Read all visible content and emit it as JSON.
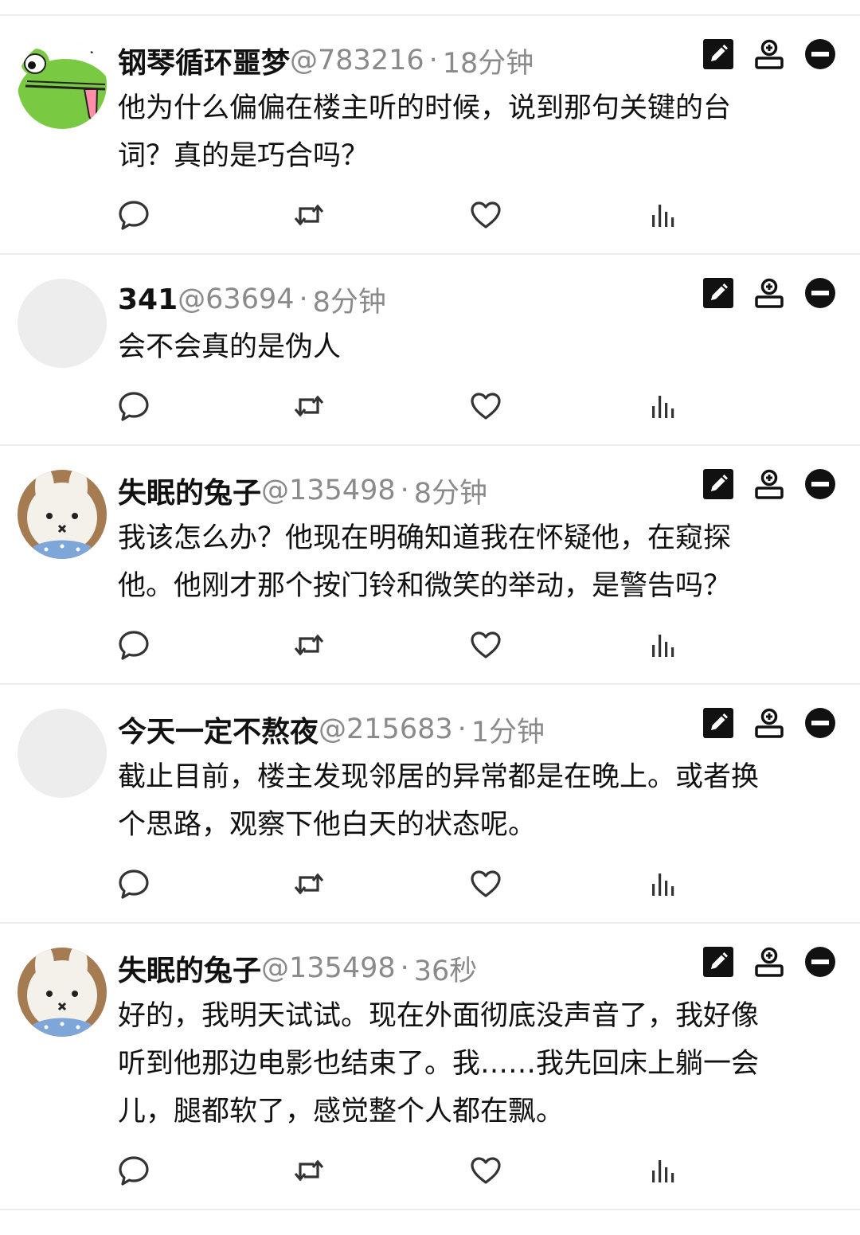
{
  "posts": [
    {
      "username": "钢琴循环噩梦",
      "handle": "@783216",
      "separator": "·",
      "time": "18分钟",
      "content": "他为什么偏偏在楼主听的时候，说到那句关键的台\n词？真的是巧合吗？",
      "avatar": "frog-avatar",
      "height": 300
    },
    {
      "username": "341",
      "handle": "@63694",
      "separator": "·",
      "time": "8分钟",
      "content": "会不会真的是伪人",
      "avatar": "blank-avatar",
      "height": 240
    },
    {
      "username": "失眠的兔子",
      "handle": "@135498",
      "separator": "·",
      "time": "8分钟",
      "content": "我该怎么办？他现在明确知道我在怀疑他，在窥探\n他。他刚才那个按门铃和微笑的举动，是警告吗？",
      "avatar": "bunny-avatar",
      "height": 300
    },
    {
      "username": "今天一定不熬夜",
      "handle": "@215683",
      "separator": "·",
      "time": "1分钟",
      "content": "截止目前，楼主发现邻居的异常都是在晚上。或者换\n个思路，观察下他白天的状态呢。",
      "avatar": "blank-avatar",
      "height": 300
    },
    {
      "username": "失眠的兔子",
      "handle": "@135498",
      "separator": "·",
      "time": "36秒",
      "content": "好的，我明天试试。现在外面彻底没声音了，我好像\n听到他那边电影也结束了。我……我先回床上躺一会\n儿，腿都软了，感觉整个人都在飘。",
      "avatar": "bunny-avatar",
      "height": 360
    }
  ],
  "icons": {
    "actions": [
      "edit-icon",
      "add-user-icon",
      "block-icon"
    ],
    "stats": [
      "reply-icon",
      "retweet-icon",
      "like-icon",
      "views-icon"
    ]
  },
  "colors": {
    "text": "#111111",
    "meta": "#8a8a8a",
    "icon": "#333333",
    "divider": "#ececec",
    "frog": "#7ac943"
  }
}
